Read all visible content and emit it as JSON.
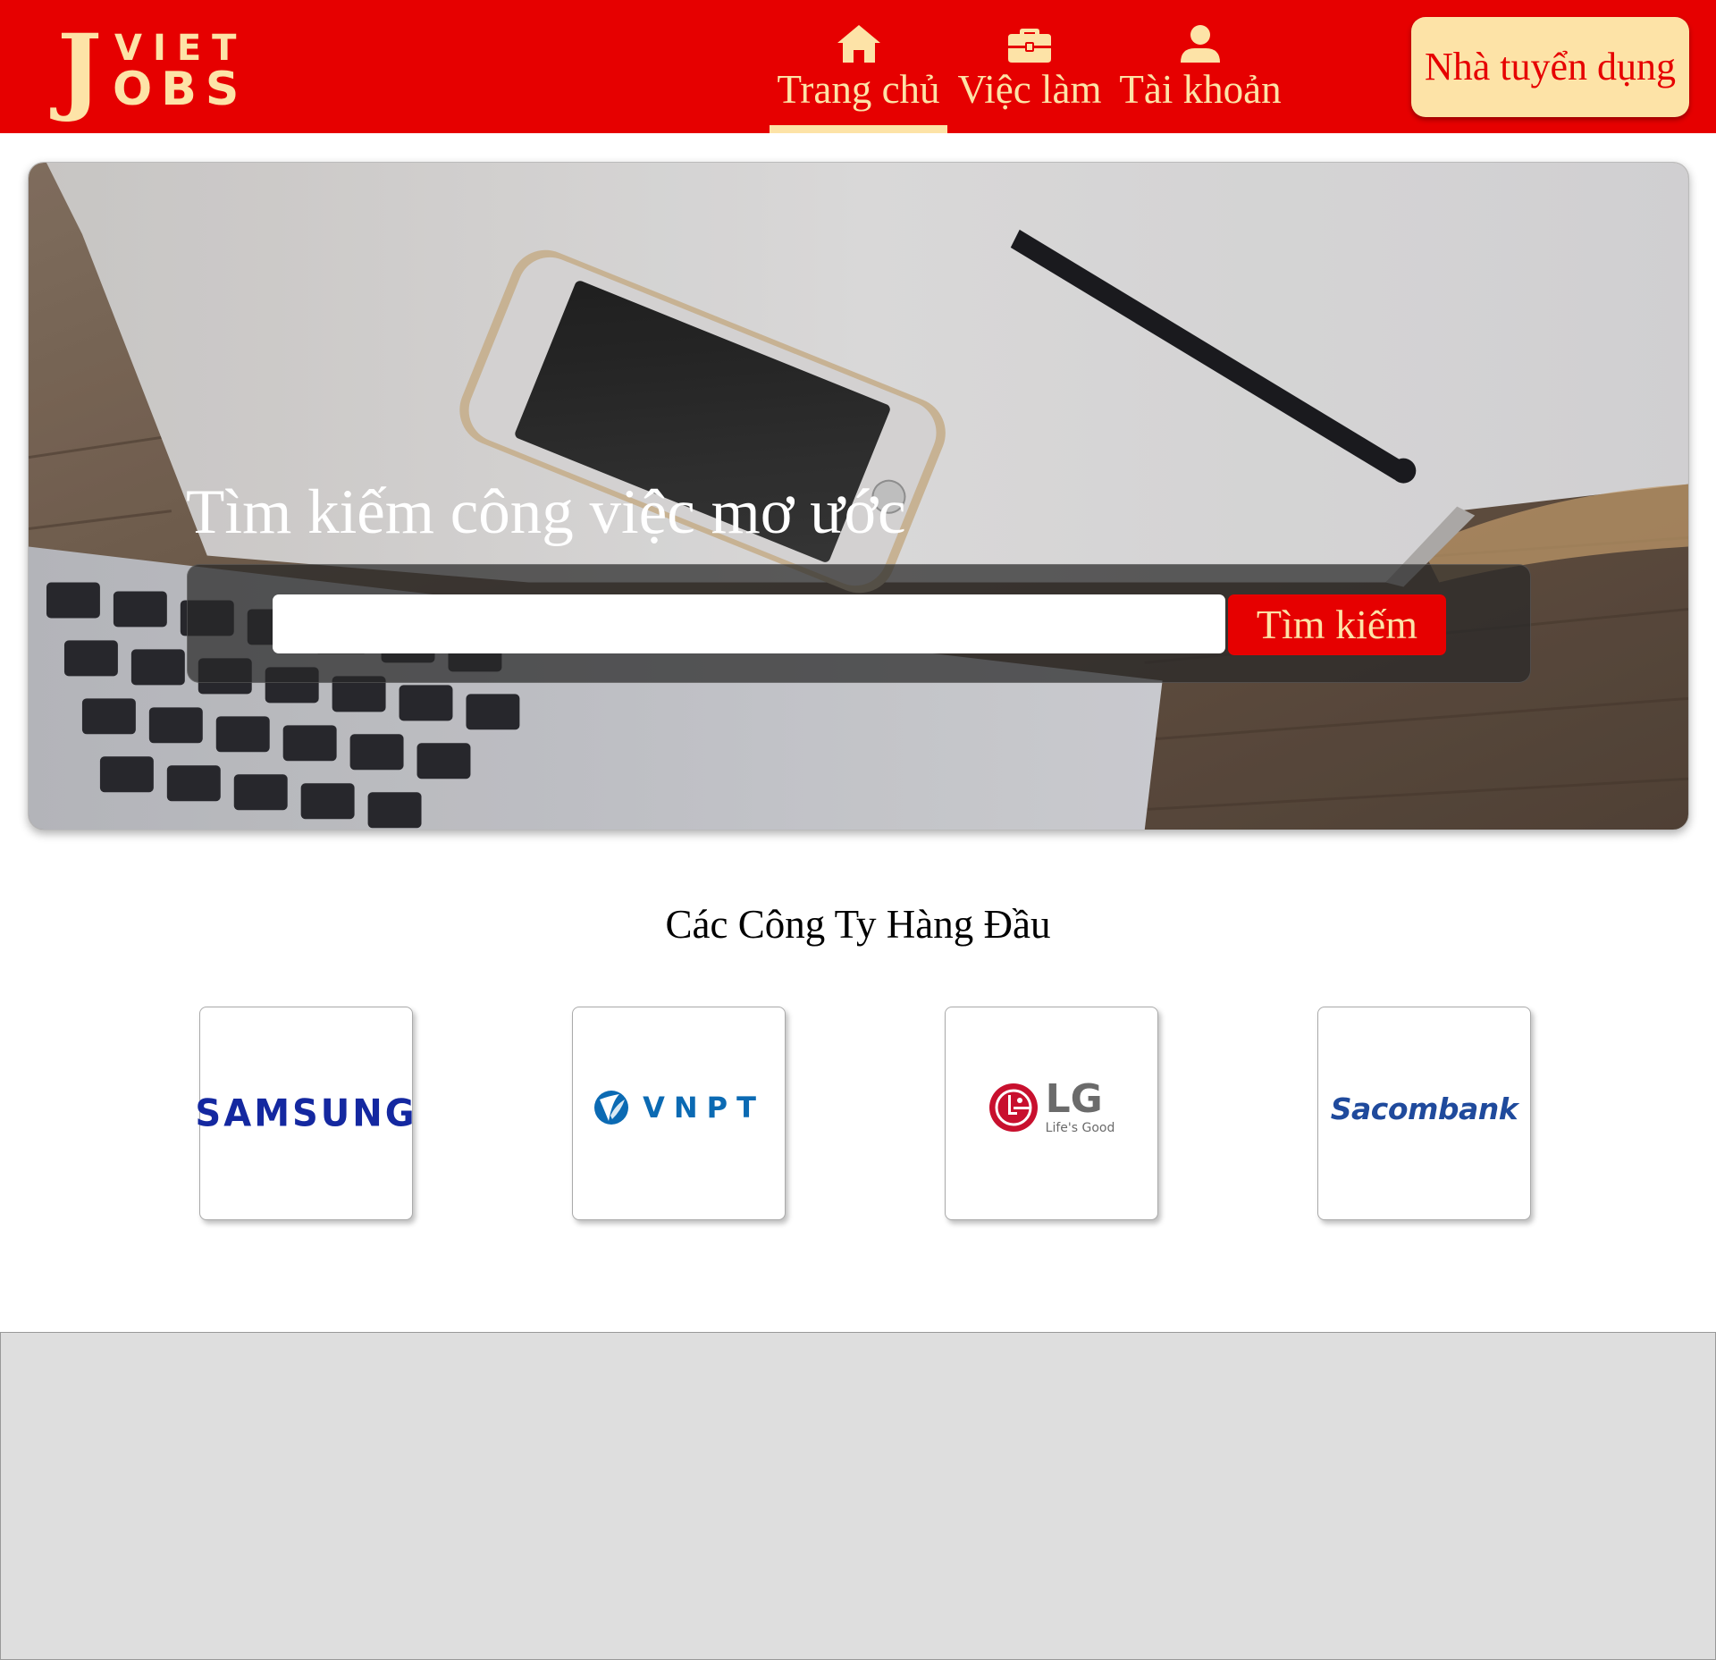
{
  "brand": {
    "logo_j": "J",
    "logo_viet": "VIET",
    "logo_obs": "OBS"
  },
  "nav": {
    "items": [
      {
        "label": "Trang chủ",
        "icon": "home-icon",
        "active": true
      },
      {
        "label": "Việc làm",
        "icon": "briefcase-icon",
        "active": false
      },
      {
        "label": "Tài khoản",
        "icon": "user-icon",
        "active": false
      }
    ],
    "employer_label": "Nhà tuyển dụng"
  },
  "hero": {
    "title": "Tìm kiếm công việc mơ ước",
    "search_value": "",
    "search_button": "Tìm kiếm"
  },
  "companies": {
    "title": "Các Công Ty Hàng Đầu",
    "items": [
      {
        "name": "SAMSUNG"
      },
      {
        "name": "VNPT"
      },
      {
        "name": "LG",
        "tagline": "Life's Good"
      },
      {
        "name": "Sacombank"
      }
    ]
  },
  "colors": {
    "primary_red": "#e60000",
    "cream": "#fde3a7",
    "footer_gray": "#dedede"
  }
}
